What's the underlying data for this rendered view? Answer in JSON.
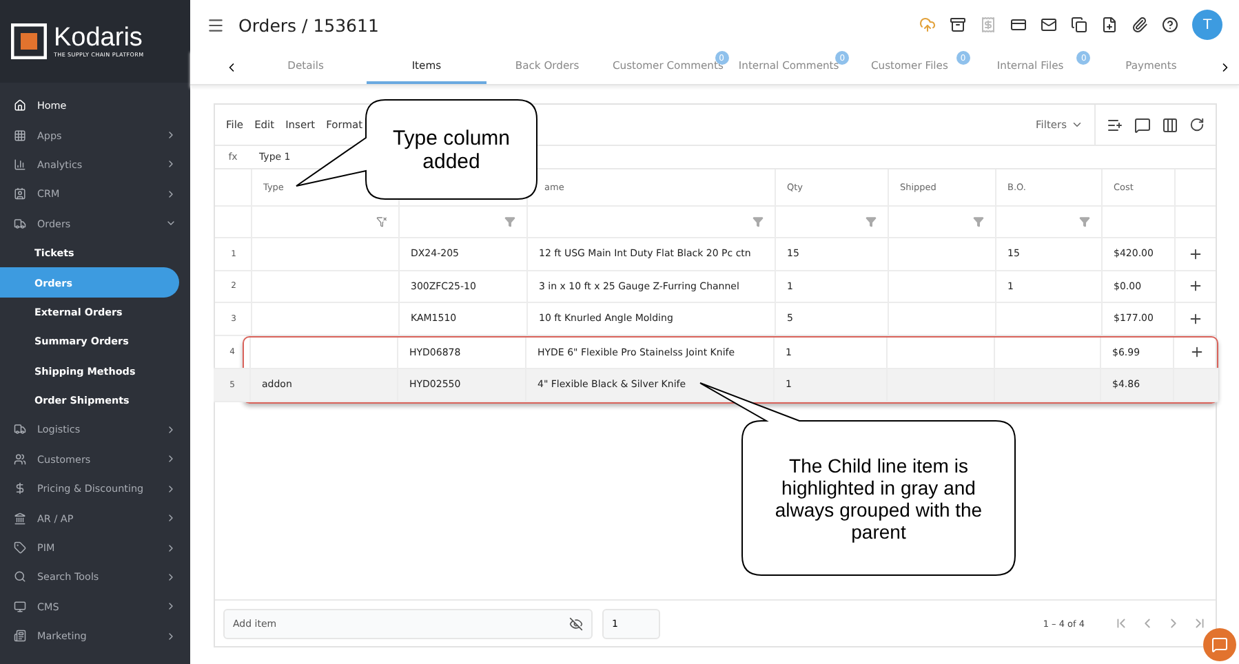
{
  "brand": {
    "name": "Kodaris",
    "tagline": "THE SUPPLY CHAIN PLATFORM"
  },
  "sidebar": {
    "items": [
      {
        "label": "Home",
        "expandable": false
      },
      {
        "label": "Apps",
        "expandable": true,
        "expanded": false
      },
      {
        "label": "Analytics",
        "expandable": true,
        "expanded": false
      },
      {
        "label": "CRM",
        "expandable": true,
        "expanded": false
      },
      {
        "label": "Orders",
        "expandable": true,
        "expanded": true,
        "children": [
          {
            "label": "Tickets",
            "selected": false
          },
          {
            "label": "Orders",
            "selected": true
          },
          {
            "label": "External Orders",
            "selected": false
          },
          {
            "label": "Summary Orders",
            "selected": false
          },
          {
            "label": "Shipping Methods",
            "selected": false
          },
          {
            "label": "Order Shipments",
            "selected": false
          }
        ]
      },
      {
        "label": "Logistics",
        "expandable": true,
        "expanded": false
      },
      {
        "label": "Customers",
        "expandable": true,
        "expanded": false
      },
      {
        "label": "Pricing & Discounting",
        "expandable": true,
        "expanded": false
      },
      {
        "label": "AR / AP",
        "expandable": true,
        "expanded": false
      },
      {
        "label": "PIM",
        "expandable": true,
        "expanded": false
      },
      {
        "label": "Search Tools",
        "expandable": true,
        "expanded": false
      },
      {
        "label": "CMS",
        "expandable": true,
        "expanded": false
      },
      {
        "label": "Marketing",
        "expandable": true,
        "expanded": false
      }
    ]
  },
  "header": {
    "title": "Orders / 153611",
    "avatar": "T"
  },
  "tabs": [
    {
      "label": "Details",
      "selected": false
    },
    {
      "label": "Items",
      "selected": true
    },
    {
      "label": "Back Orders",
      "selected": false
    },
    {
      "label": "Customer Comments",
      "selected": false,
      "badge": "0"
    },
    {
      "label": "Internal Comments",
      "selected": false,
      "badge": "0"
    },
    {
      "label": "Customer Files",
      "selected": false,
      "badge": "0"
    },
    {
      "label": "Internal Files",
      "selected": false,
      "badge": "0"
    },
    {
      "label": "Payments",
      "selected": false
    }
  ],
  "grid": {
    "menu": [
      "File",
      "Edit",
      "Insert",
      "Format"
    ],
    "filters": "Filters",
    "formula_label": "fx",
    "formula": "Type 1",
    "columns": [
      "Type",
      "",
      "ame",
      "Qty",
      "Shipped",
      "B.O.",
      "Cost"
    ],
    "rows": [
      {
        "number": "1",
        "type": "",
        "sku": "DX24-205",
        "name": "12 ft USG Main Int Duty Flat Black 20 Pc ctn",
        "qty": "15",
        "shipped": "",
        "bo": "15",
        "cost": "$420.00",
        "child": false,
        "add_button": true,
        "outlined": false
      },
      {
        "number": "2",
        "type": "",
        "sku": "300ZFC25-10",
        "name": "3 in x 10 ft x 25 Gauge Z-Furring Channel",
        "qty": "1",
        "shipped": "",
        "bo": "1",
        "cost": "$0.00",
        "child": false,
        "add_button": true,
        "outlined": false
      },
      {
        "number": "3",
        "type": "",
        "sku": "KAM1510",
        "name": "10 ft Knurled Angle Molding",
        "qty": "5",
        "shipped": "",
        "bo": "",
        "cost": "$177.00",
        "child": false,
        "add_button": true,
        "outlined": false
      },
      {
        "number": "4",
        "type": "",
        "sku": "HYD06878",
        "name": "HYDE 6\" Flexible Pro Stainelss Joint Knife",
        "qty": "1",
        "shipped": "",
        "bo": "",
        "cost": "$6.99",
        "child": false,
        "add_button": true,
        "outlined": true
      },
      {
        "number": "5",
        "type": "addon",
        "sku": "HYD02550",
        "name": "4\" Flexible Black & Silver Knife",
        "qty": "1",
        "shipped": "",
        "bo": "",
        "cost": "$4.86",
        "child": true,
        "add_button": false,
        "outlined": true
      }
    ],
    "add_item": {
      "placeholder": "Add item"
    },
    "quantity": "1",
    "range": "1 – 4 of 4"
  },
  "callouts": [
    {
      "text": "Type column added"
    },
    {
      "text": "The Child line item is highlighted in gray and always grouped with the parent"
    }
  ]
}
